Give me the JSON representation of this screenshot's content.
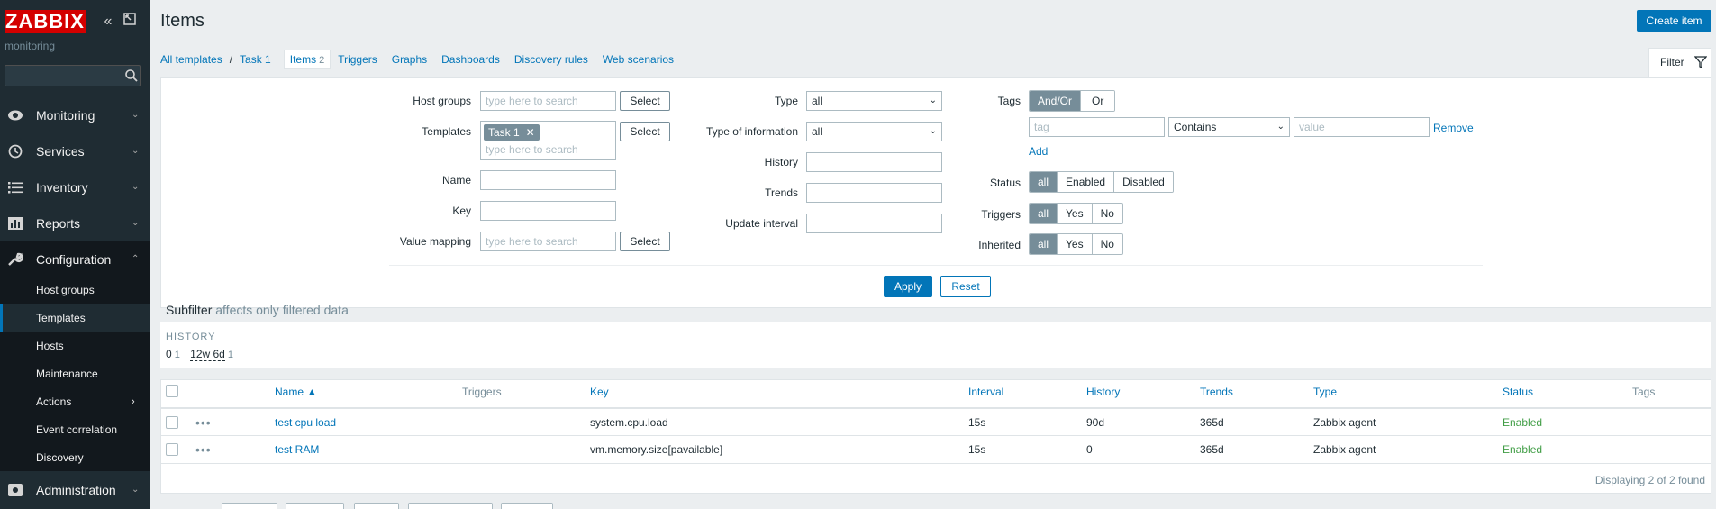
{
  "sidebar": {
    "logo": "ZABBIX",
    "subtitle": "monitoring",
    "menu": [
      {
        "label": "Monitoring",
        "icon": "eye-icon"
      },
      {
        "label": "Services",
        "icon": "clock-icon"
      },
      {
        "label": "Inventory",
        "icon": "list-icon"
      },
      {
        "label": "Reports",
        "icon": "chart-icon"
      },
      {
        "label": "Configuration",
        "icon": "wrench-icon"
      },
      {
        "label": "Administration",
        "icon": "gear-icon"
      }
    ],
    "submenu": [
      "Host groups",
      "Templates",
      "Hosts",
      "Maintenance",
      "Actions",
      "Event correlation",
      "Discovery"
    ]
  },
  "header": {
    "title": "Items",
    "create_label": "Create item"
  },
  "nav": {
    "all_templates": "All templates",
    "separator": "/",
    "template": "Task 1",
    "current_tab": "Items",
    "current_count": "2",
    "tabs": [
      "Triggers",
      "Graphs",
      "Dashboards",
      "Discovery rules",
      "Web scenarios"
    ],
    "filter_label": "Filter"
  },
  "filter": {
    "host_groups_label": "Host groups",
    "templates_label": "Templates",
    "name_label": "Name",
    "key_label": "Key",
    "value_mapping_label": "Value mapping",
    "search_placeholder": "type here to search",
    "select_label": "Select",
    "template_chip": "Task 1",
    "type_label": "Type",
    "type_value": "all",
    "type_info_label": "Type of information",
    "type_info_value": "all",
    "history_label": "History",
    "trends_label": "Trends",
    "update_interval_label": "Update interval",
    "tags_label": "Tags",
    "tags_andor": "And/Or",
    "tags_or": "Or",
    "tag_placeholder": "tag",
    "tag_operator": "Contains",
    "value_placeholder": "value",
    "remove_label": "Remove",
    "add_label": "Add",
    "status_label": "Status",
    "status_opts": [
      "all",
      "Enabled",
      "Disabled"
    ],
    "triggers_label": "Triggers",
    "triggers_opts": [
      "all",
      "Yes",
      "No"
    ],
    "inherited_label": "Inherited",
    "inherited_opts": [
      "all",
      "Yes",
      "No"
    ],
    "apply_label": "Apply",
    "reset_label": "Reset"
  },
  "subfilter": {
    "title": "Subfilter",
    "note": "affects only filtered data",
    "history_heading": "HISTORY",
    "values": [
      {
        "value": "0",
        "count": "1"
      },
      {
        "value": "12w 6d",
        "count": "1"
      }
    ]
  },
  "table": {
    "headers": {
      "name": "Name ▲",
      "triggers": "Triggers",
      "key": "Key",
      "interval": "Interval",
      "history": "History",
      "trends": "Trends",
      "type": "Type",
      "status": "Status",
      "tags": "Tags"
    },
    "rows": [
      {
        "name": "test cpu load",
        "key": "system.cpu.load",
        "interval": "15s",
        "history": "90d",
        "trends": "365d",
        "type": "Zabbix agent",
        "status": "Enabled"
      },
      {
        "name": "test RAM",
        "key": "vm.memory.size[pavailable]",
        "interval": "15s",
        "history": "0",
        "trends": "365d",
        "type": "Zabbix agent",
        "status": "Enabled"
      }
    ],
    "footer": "Displaying 2 of 2 found"
  },
  "colors": {
    "accent": "#0275b8",
    "sidebar": "#1f2c33",
    "logo": "#d40000",
    "enabled": "#429e47"
  }
}
